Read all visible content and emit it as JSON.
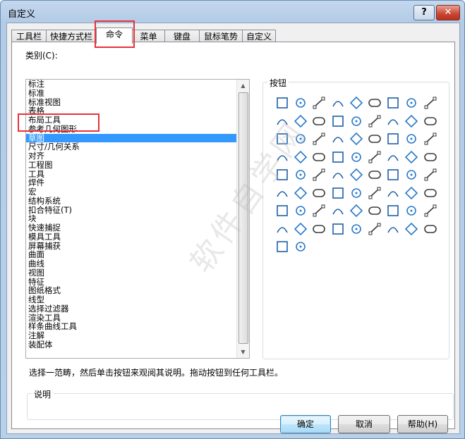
{
  "window": {
    "title": "自定义",
    "help_glyph": "?",
    "close_glyph": "✕"
  },
  "tabs": [
    "工具栏",
    "快捷方式栏",
    "命令",
    "菜单",
    "键盘",
    "鼠标笔势",
    "自定义"
  ],
  "category": {
    "label": "类别(C):",
    "items": [
      "标注",
      "标准",
      "标准视图",
      "表格",
      "布局工具",
      "参考几何图形",
      "草图",
      "尺寸/几何关系",
      "对齐",
      "工程图",
      "工具",
      "焊件",
      "宏",
      "结构系统",
      "扣合特征(T)",
      "块",
      "快速捕捉",
      "模具工具",
      "屏幕捕获",
      "曲面",
      "曲线",
      "视图",
      "特征",
      "图纸格式",
      "线型",
      "选择过滤器",
      "渲染工具",
      "样条曲线工具",
      "注解",
      "装配体"
    ],
    "selected_index": 6,
    "scroll_up": "▲",
    "scroll_down": "▼"
  },
  "buttons_group": {
    "title": "按钮",
    "icons": [
      "select-pointer-icon",
      "grid-icon",
      "sketch-icon",
      "3d-sketch-icon",
      "3d-sketch-on-plane-icon",
      "sketch-stack-icon",
      "quick-sketch-icon",
      "instant-2d-icon",
      "sketch-picture-icon",
      "line-icon",
      "corner-rectangle-icon",
      "center-rectangle-icon",
      "3-point-rectangle-icon",
      "3-point-center-rectangle-icon",
      "parallelogram-icon",
      "straight-slot-icon",
      "centerpoint-slot-icon",
      "3-point-arc-slot-icon",
      "centerpoint-arc-slot-icon",
      "polygon-icon",
      "circle-icon",
      "perimeter-circle-icon",
      "centerpoint-arc-icon",
      "tangent-arc-icon",
      "3-point-arc-icon",
      "ellipse-icon",
      "partial-ellipse-icon",
      "parabola-icon",
      "conic-icon",
      "spline-icon",
      "spline-on-surface-icon",
      "equation-curve-icon",
      "point-icon",
      "centerline-icon",
      "midpoint-line-icon",
      "text-icon",
      "plane-icon",
      "fillet-icon",
      "chamfer-icon",
      "offset-entities-icon",
      "offset-on-surface-icon",
      "convert-entities-icon",
      "intersection-curve-icon",
      "face-curves-icon",
      "segment-icon",
      "trim-icon",
      "extend-icon",
      "split-entities-icon",
      "jog-line-icon",
      "mirror-icon",
      "dynamic-mirror-icon",
      "move-entities-icon",
      "rotate-entities-icon",
      "scale-entities-icon",
      "copy-entities-icon",
      "stretch-entities-icon",
      "linear-pattern-icon",
      "circular-pattern-icon",
      "make-path-icon",
      "modify-sketch-icon",
      "close-loop-icon",
      "fully-define-icon",
      "add-relation-icon",
      "display-relations-icon",
      "repair-sketch-icon",
      "check-sketch-icon",
      "sketch-picture-2-icon",
      "block-insert-icon",
      "shaded-sketch-icon",
      "route-line-icon",
      "spline-tools-icon",
      "dimension-icon",
      "relations-icon",
      "select-chain-icon"
    ]
  },
  "hint": "选择一范畴，然后单击按钮来观阅其说明。拖动按钮到任何工具栏。",
  "description": {
    "title": "说明"
  },
  "footer": {
    "ok": "确定",
    "cancel": "取消",
    "help": "帮助(H)"
  },
  "watermark": "软件自学网"
}
